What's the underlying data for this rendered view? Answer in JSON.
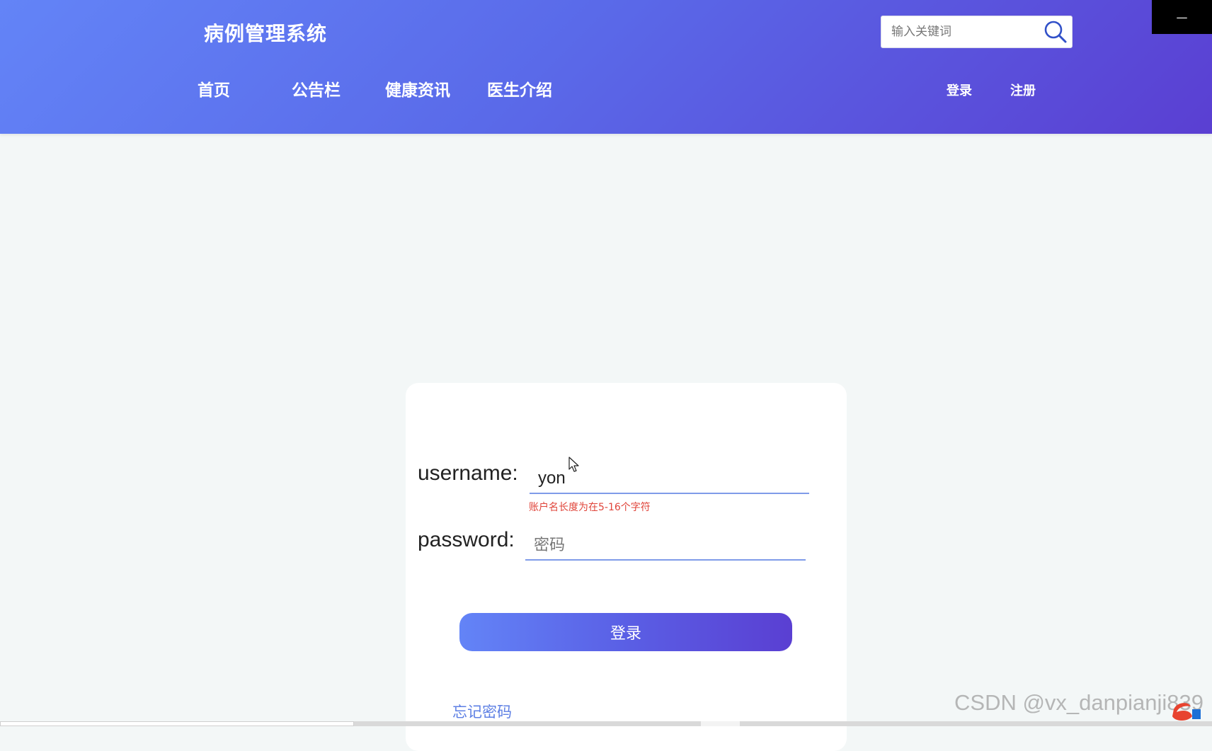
{
  "header": {
    "site_title": "病例管理系统",
    "search_placeholder": "输入关键词",
    "window_button": "—",
    "nav": [
      {
        "label": "首页"
      },
      {
        "label": "公告栏"
      },
      {
        "label": "健康资讯"
      },
      {
        "label": "医生介绍"
      }
    ],
    "login_link": "登录",
    "register_link": "注册"
  },
  "login_form": {
    "username_label": "username:",
    "username_value": "yon",
    "username_error": "账户名长度为在5-16个字符",
    "password_label": "password:",
    "password_placeholder": "密码",
    "submit_label": "登录",
    "forgot_label": "忘记密码"
  },
  "watermark": "CSDN @vx_danpianji839",
  "colors": {
    "header_start": "#6384f7",
    "header_end": "#5a3fd2",
    "error": "#e0443a",
    "link": "#5d7fe4"
  },
  "icons": {
    "search": "search-icon",
    "cursor": "mouse-pointer-icon"
  }
}
